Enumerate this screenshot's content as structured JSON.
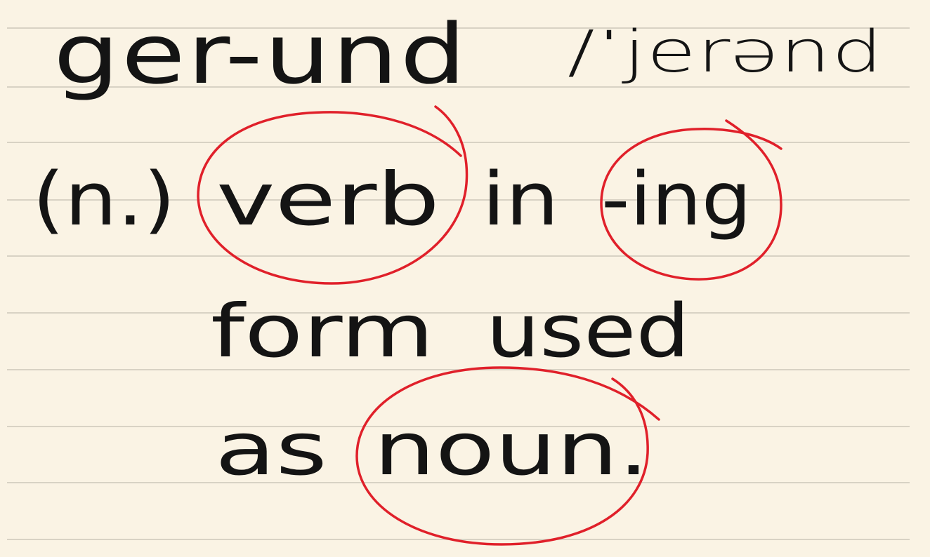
{
  "note": {
    "headword": "ger-und",
    "pronunciation": "/ˈjerənd",
    "part_of_speech": "(n.)",
    "definition_words": {
      "w1": "verb",
      "w2": "in",
      "w3": "-ing",
      "w4": "form",
      "w5": "used",
      "w6": "as",
      "w7": "noun."
    },
    "highlighted_words": [
      "verb",
      "-ing",
      "noun"
    ]
  },
  "colors": {
    "paper": "#faf3e4",
    "ruled_line": "#d8d2c4",
    "ink": "#141414",
    "highlight_circle": "#e0202a"
  }
}
